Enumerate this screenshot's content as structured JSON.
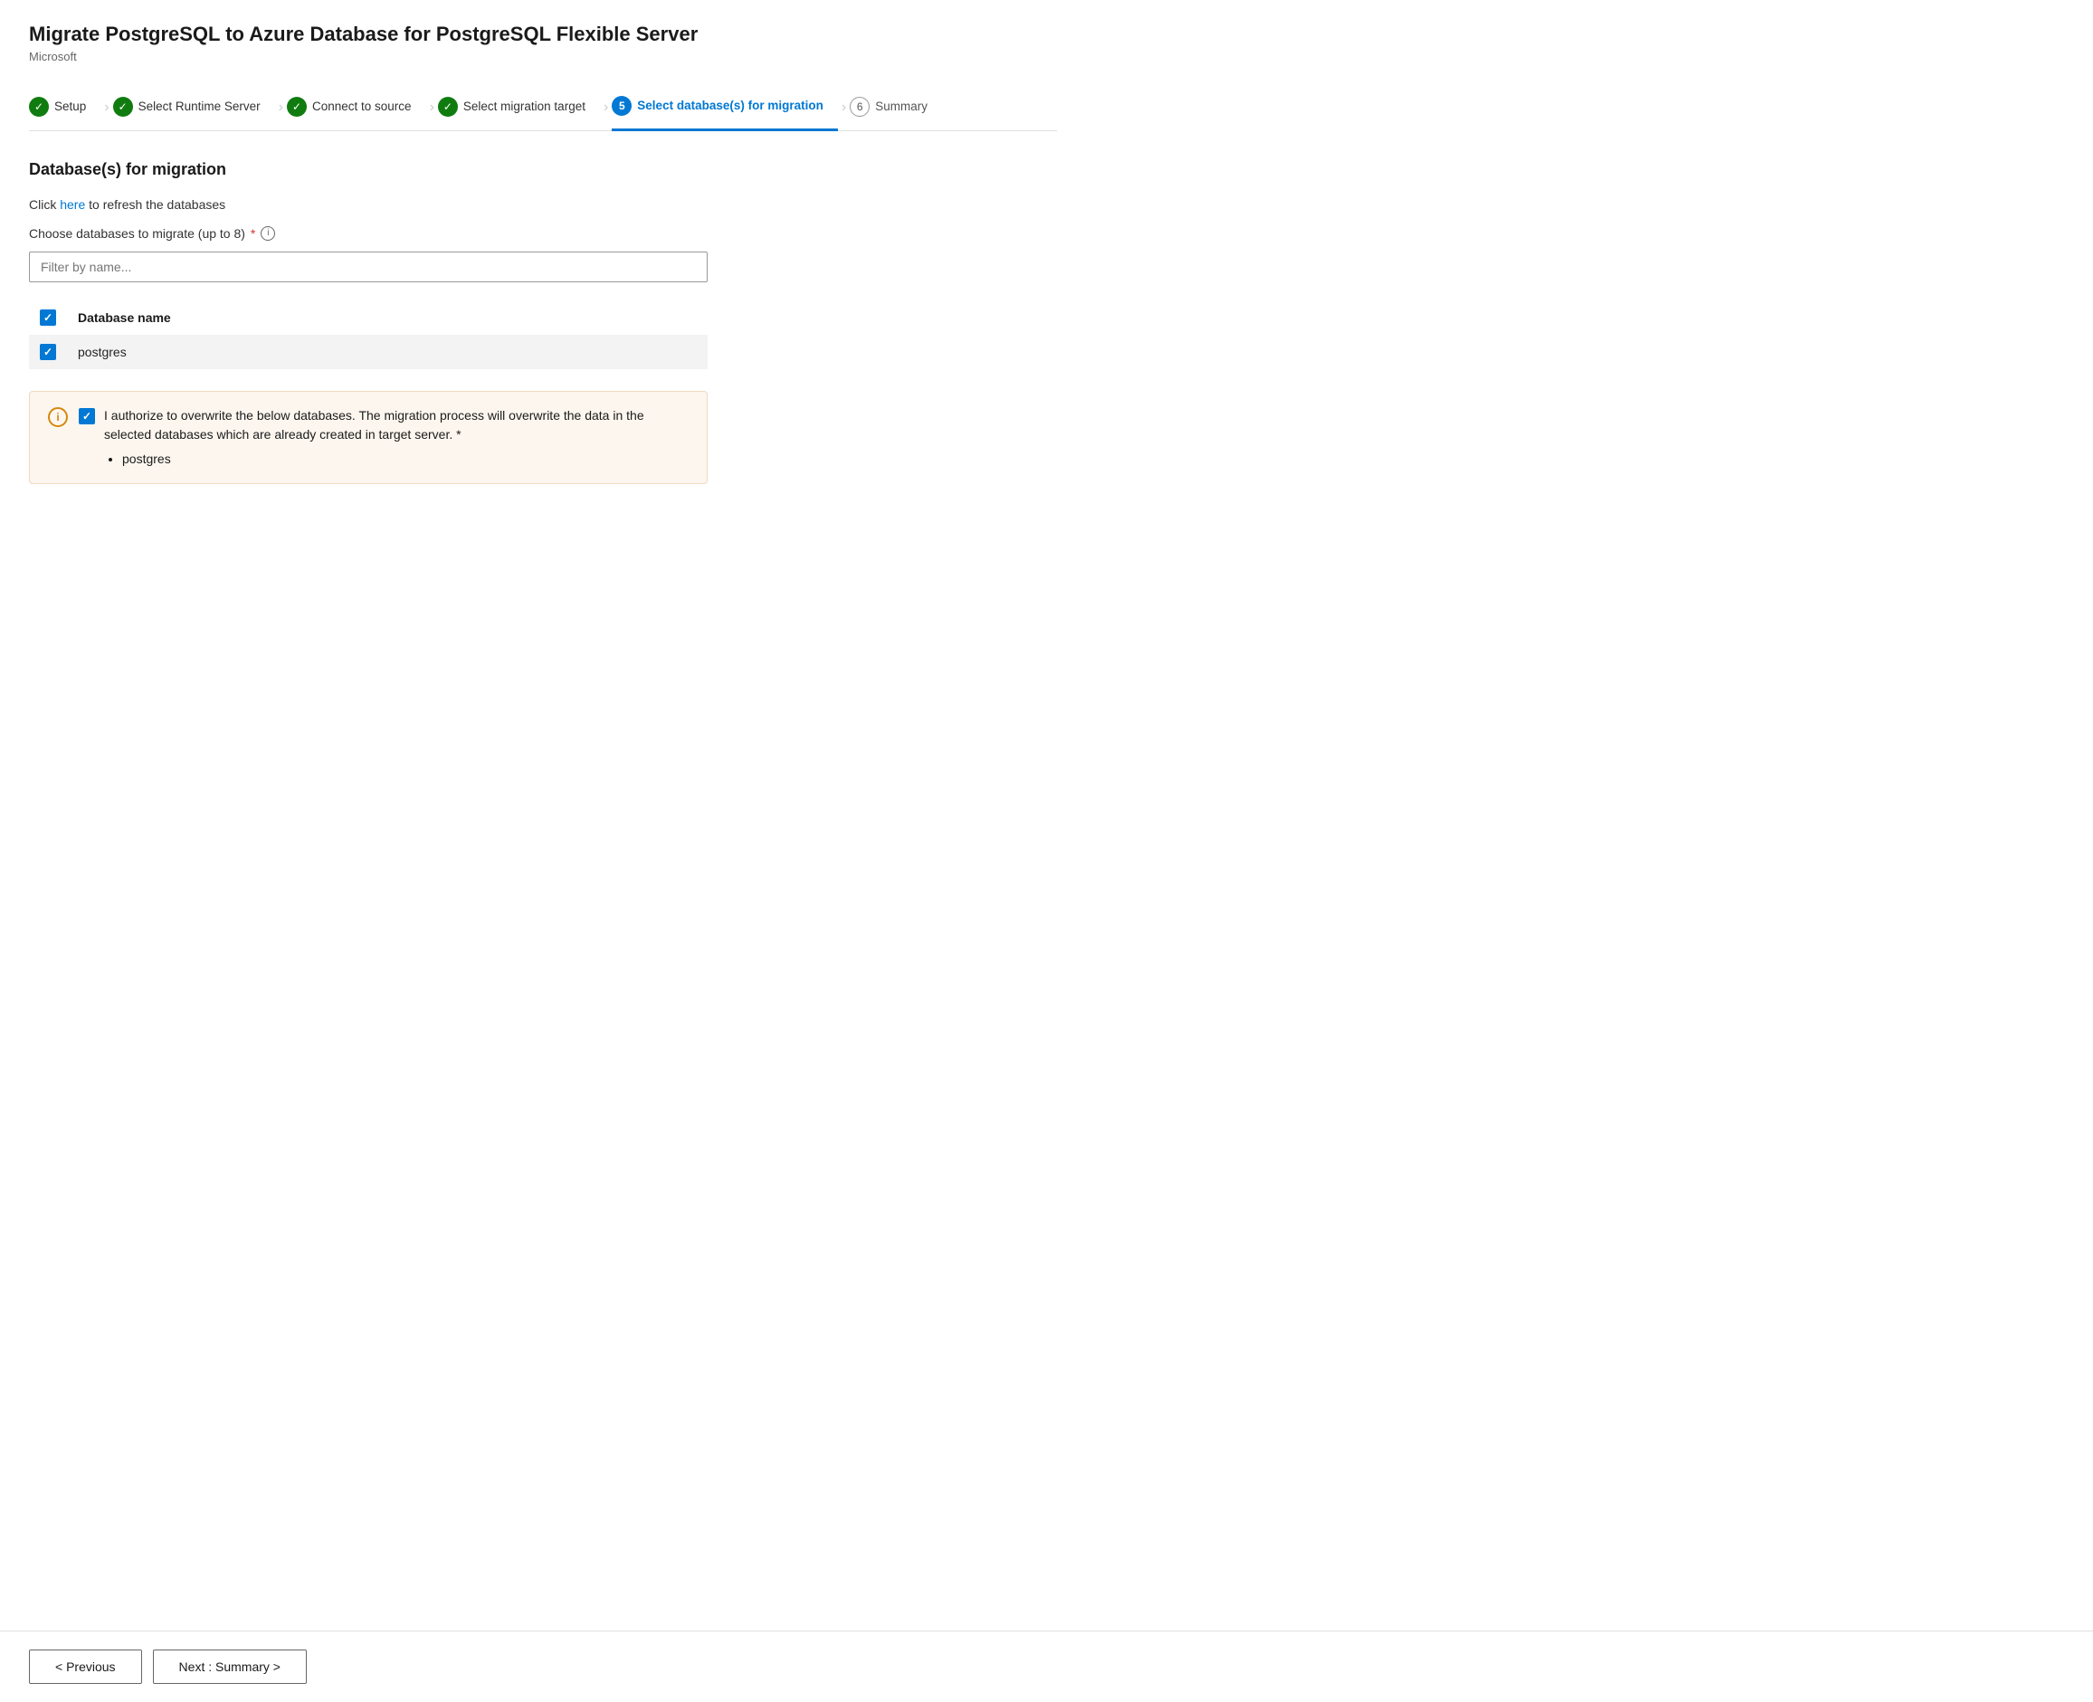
{
  "app": {
    "title": "Migrate PostgreSQL to Azure Database for PostgreSQL Flexible Server",
    "subtitle": "Microsoft",
    "more_icon": "···"
  },
  "stepper": {
    "steps": [
      {
        "id": "setup",
        "label": "Setup",
        "state": "completed",
        "number": "1"
      },
      {
        "id": "runtime-server",
        "label": "Select Runtime Server",
        "state": "completed",
        "number": "2"
      },
      {
        "id": "connect-source",
        "label": "Connect to source",
        "state": "completed",
        "number": "3"
      },
      {
        "id": "migration-target",
        "label": "Select migration target",
        "state": "completed",
        "number": "4"
      },
      {
        "id": "select-databases",
        "label": "Select database(s) for migration",
        "state": "active",
        "number": "5"
      },
      {
        "id": "summary",
        "label": "Summary",
        "state": "pending",
        "number": "6"
      }
    ]
  },
  "main": {
    "section_title": "Database(s) for migration",
    "refresh_text": "Click",
    "refresh_link": "here",
    "refresh_suffix": "to refresh the databases",
    "choose_label": "Choose databases to migrate (up to 8)",
    "filter_placeholder": "Filter by name...",
    "table": {
      "header_checkbox": true,
      "column_header": "Database name",
      "rows": [
        {
          "name": "postgres",
          "checked": true
        }
      ]
    },
    "authorization": {
      "text_main": "I authorize to overwrite the below databases. The migration process will overwrite the data in the selected databases which are already created in target server. *",
      "databases": [
        "postgres"
      ],
      "checked": true
    }
  },
  "footer": {
    "previous_label": "< Previous",
    "next_label": "Next : Summary >"
  }
}
